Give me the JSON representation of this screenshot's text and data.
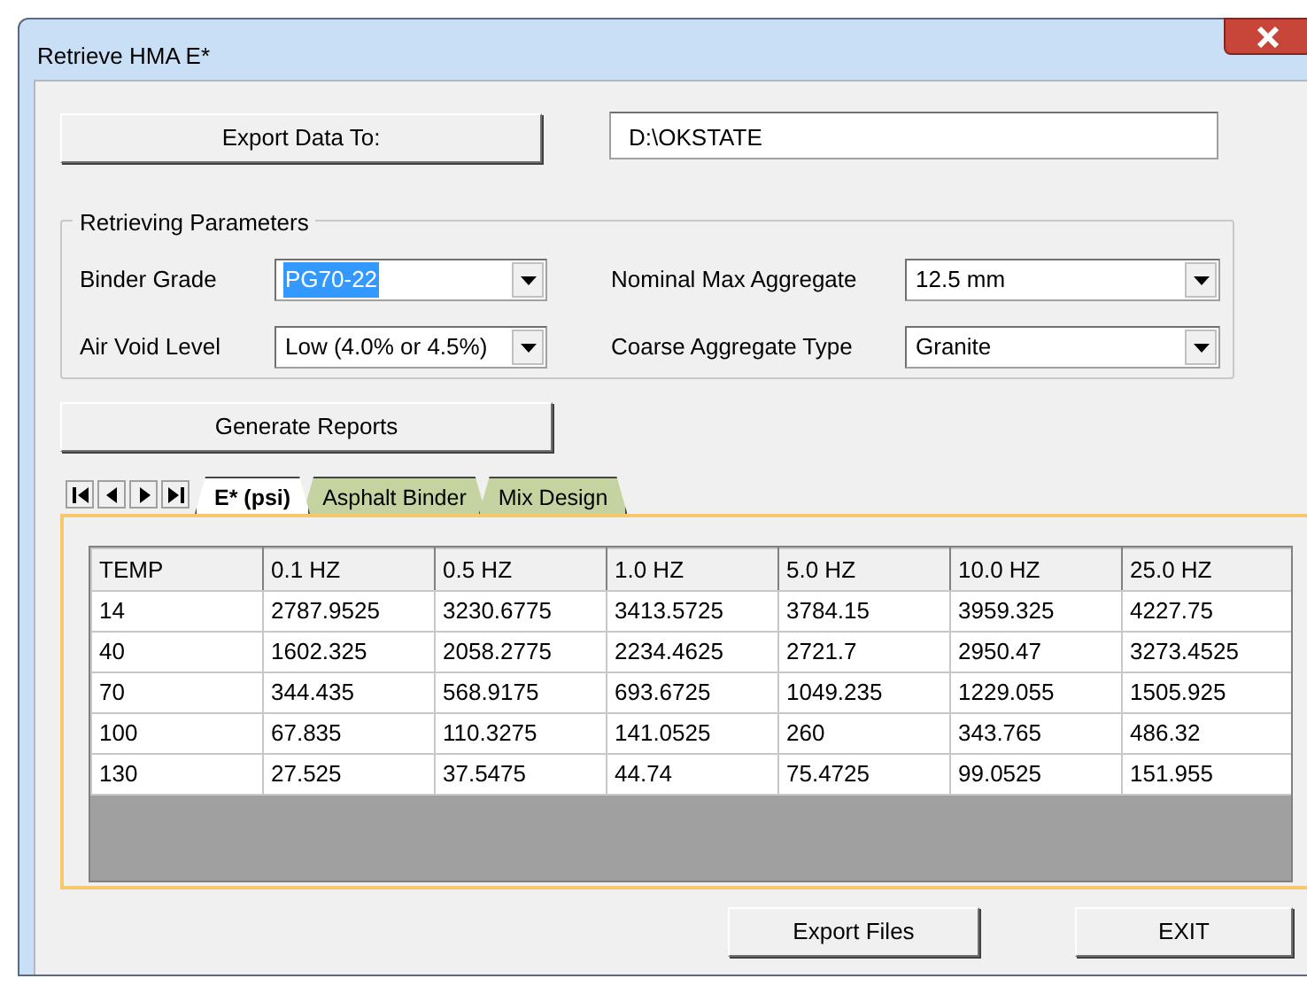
{
  "window": {
    "title": "Retrieve HMA E*"
  },
  "export_button": "Export Data To:",
  "path_field": {
    "value": "D:\\OKSTATE"
  },
  "parameters": {
    "title": "Retrieving Parameters",
    "fields": [
      {
        "label": "Binder Grade",
        "value": "PG70-22",
        "highlighted": true
      },
      {
        "label": "Nominal Max Aggregate",
        "value": "12.5 mm",
        "highlighted": false
      },
      {
        "label": "Air Void Level",
        "value": "Low (4.0% or 4.5%)",
        "highlighted": false
      },
      {
        "label": "Coarse Aggregate Type",
        "value": "Granite",
        "highlighted": false
      }
    ]
  },
  "generate_button": "Generate Reports",
  "tabs": [
    {
      "label": "E* (psi)",
      "selected": true
    },
    {
      "label": "Asphalt Binder",
      "selected": false
    },
    {
      "label": "Mix Design",
      "selected": false
    }
  ],
  "table": {
    "columns": [
      "TEMP",
      "0.1 HZ",
      "0.5 HZ",
      "1.0 HZ",
      "5.0 HZ",
      "10.0 HZ",
      "25.0 HZ"
    ],
    "rows": [
      [
        "14",
        "2787.9525",
        "3230.6775",
        "3413.5725",
        "3784.15",
        "3959.325",
        "4227.75"
      ],
      [
        "40",
        "1602.325",
        "2058.2775",
        "2234.4625",
        "2721.7",
        "2950.47",
        "3273.4525"
      ],
      [
        "70",
        "344.435",
        "568.9175",
        "693.6725",
        "1049.235",
        "1229.055",
        "1505.925"
      ],
      [
        "100",
        "67.835",
        "110.3275",
        "141.0525",
        "260",
        "343.765",
        "486.32"
      ],
      [
        "130",
        "27.525",
        "37.5475",
        "44.74",
        "75.4725",
        "99.0525",
        "151.955"
      ]
    ]
  },
  "buttons": [
    "Export Files",
    "EXIT"
  ]
}
